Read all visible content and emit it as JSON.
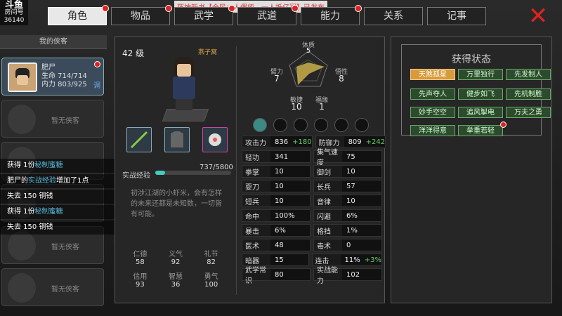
{
  "stream": {
    "logo": "斗鱼",
    "room_label": "房间号",
    "room": "36140",
    "banner": "死神新书【全民：人偶师，一人抵亿军】已发布"
  },
  "tabs": [
    {
      "label": "角色",
      "active": true,
      "dot": true
    },
    {
      "label": "物品",
      "dot": true
    },
    {
      "label": "武学",
      "dot": true
    },
    {
      "label": "武道",
      "dot": true
    },
    {
      "label": "能力",
      "dot": true
    },
    {
      "label": "关系"
    },
    {
      "label": "记事"
    }
  ],
  "sidebar": {
    "title": "我的侠客",
    "hero": {
      "name": "肥尸",
      "hp": "生命 714/714",
      "mp": "内力 803/925",
      "tag": "调"
    },
    "empty": "暂无侠客"
  },
  "log": [
    {
      "pre": "获得 1份",
      "hl": "秘制蜜糖",
      "post": ""
    },
    {
      "pre": "肥尸的",
      "hl": "实战经验",
      "post": "增加了1点"
    },
    {
      "pre": "失去 150 铜钱",
      "hl": "",
      "post": ""
    },
    {
      "pre": "获得 1份",
      "hl": "秘制蜜糖",
      "post": ""
    },
    {
      "pre": "失去 150 铜钱",
      "hl": "",
      "post": ""
    }
  ],
  "char": {
    "level": "42 级",
    "nickname": "燕子窝",
    "exp_label": "实战经验",
    "exp_value": "737/5800",
    "exp_fraction": 0.127,
    "desc": "初涉江湖的小虾米，会有怎样的未来还都是未知数，一切皆有可能。",
    "attrs": [
      {
        "n": "仁德",
        "v": "58"
      },
      {
        "n": "义气",
        "v": "92"
      },
      {
        "n": "礼节",
        "v": "82"
      },
      {
        "n": "信用",
        "v": "93"
      },
      {
        "n": "智慧",
        "v": "36"
      },
      {
        "n": "勇气",
        "v": "100"
      }
    ]
  },
  "radar": {
    "labels": {
      "top": "体质",
      "left": "臂力",
      "right": "悟性",
      "bl": "敏捷",
      "br": "福缘"
    },
    "values": {
      "top": "5",
      "left": "7",
      "right": "8",
      "bl": "10",
      "br": "1"
    }
  },
  "stats": [
    [
      {
        "k": "攻击力",
        "v": "836",
        "b": "+180"
      },
      {
        "k": "防御力",
        "v": "809",
        "b": "+242"
      }
    ],
    [
      {
        "k": "轻功",
        "v": "341"
      },
      {
        "k": "集气速度",
        "v": "75"
      }
    ],
    [
      {
        "k": "拳掌",
        "v": "10"
      },
      {
        "k": "御剑",
        "v": "10"
      }
    ],
    [
      {
        "k": "耍刀",
        "v": "10"
      },
      {
        "k": "长兵",
        "v": "57"
      }
    ],
    [
      {
        "k": "短兵",
        "v": "10"
      },
      {
        "k": "音律",
        "v": "10"
      }
    ],
    [
      {
        "k": "命中",
        "v": "100%"
      },
      {
        "k": "闪避",
        "v": "6%"
      }
    ],
    [
      {
        "k": "暴击",
        "v": "6%"
      },
      {
        "k": "格挡",
        "v": "1%"
      }
    ],
    [
      {
        "k": "医术",
        "v": "48"
      },
      {
        "k": "毒术",
        "v": "0"
      }
    ],
    [
      {
        "k": "暗器",
        "v": "15"
      },
      {
        "k": "连击",
        "v": "11%",
        "b": "+3%"
      }
    ],
    [
      {
        "k": "武学常识",
        "v": "80"
      },
      {
        "k": "实战能力",
        "v": "102"
      }
    ]
  ],
  "status": {
    "title": "获得状态",
    "tags": [
      {
        "label": "天煞孤星",
        "color": "orange"
      },
      {
        "label": "万里独行"
      },
      {
        "label": "先发制人"
      },
      {
        "label": "先声夺人"
      },
      {
        "label": "健步如飞"
      },
      {
        "label": "先机制胜"
      },
      {
        "label": "妙手空空"
      },
      {
        "label": "追风掣电"
      },
      {
        "label": "万夫之勇"
      },
      {
        "label": "洋洋得意"
      },
      {
        "label": "举重若轻",
        "dot": true
      }
    ]
  }
}
